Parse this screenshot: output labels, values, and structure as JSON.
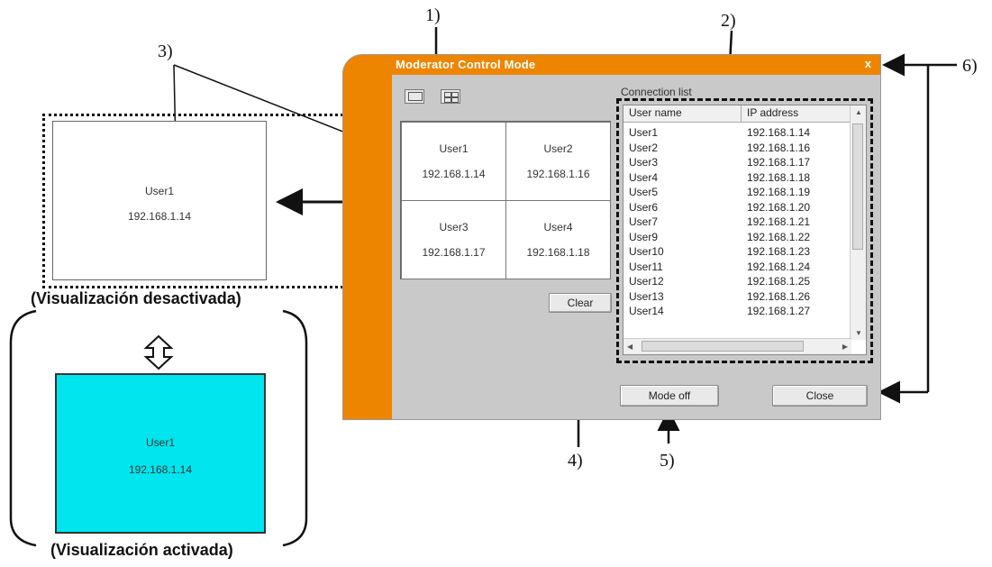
{
  "callouts": {
    "c1": "1)",
    "c2": "2)",
    "c3": "3)",
    "c4": "4)",
    "c5": "5)",
    "c6": "6)"
  },
  "window": {
    "title": "Moderator Control Mode",
    "close_glyph": "x",
    "toolbar": {
      "icons": [
        "single-view-icon",
        "quad-view-icon"
      ]
    },
    "grid": [
      {
        "user": "User1",
        "ip": "192.168.1.14"
      },
      {
        "user": "User2",
        "ip": "192.168.1.16"
      },
      {
        "user": "User3",
        "ip": "192.168.1.17"
      },
      {
        "user": "User4",
        "ip": "192.168.1.18"
      }
    ],
    "clear_label": "Clear",
    "connection_list_label": "Connection list",
    "columns": [
      "User name",
      "IP address"
    ],
    "rows": [
      [
        "User1",
        "192.168.1.14"
      ],
      [
        "User2",
        "192.168.1.16"
      ],
      [
        "User3",
        "192.168.1.17"
      ],
      [
        "User4",
        "192.168.1.18"
      ],
      [
        "User5",
        "192.168.1.19"
      ],
      [
        "User6",
        "192.168.1.20"
      ],
      [
        "User7",
        "192.168.1.21"
      ],
      [
        "User9",
        "192.168.1.22"
      ],
      [
        "User10",
        "192.168.1.23"
      ],
      [
        "User11",
        "192.168.1.24"
      ],
      [
        "User12",
        "192.168.1.25"
      ],
      [
        "User13",
        "192.168.1.26"
      ],
      [
        "User14",
        "192.168.1.27"
      ]
    ],
    "mode_off_label": "Mode off",
    "close_label": "Close"
  },
  "previews": {
    "off": {
      "user": "User1",
      "ip": "192.168.1.14",
      "caption": "(Visualización  desactivada)"
    },
    "on": {
      "user": "User1",
      "ip": "192.168.1.14",
      "caption": "(Visualización activada)"
    }
  },
  "colors": {
    "window_orange": "#ee8500",
    "active_preview": "#00e5ee"
  }
}
